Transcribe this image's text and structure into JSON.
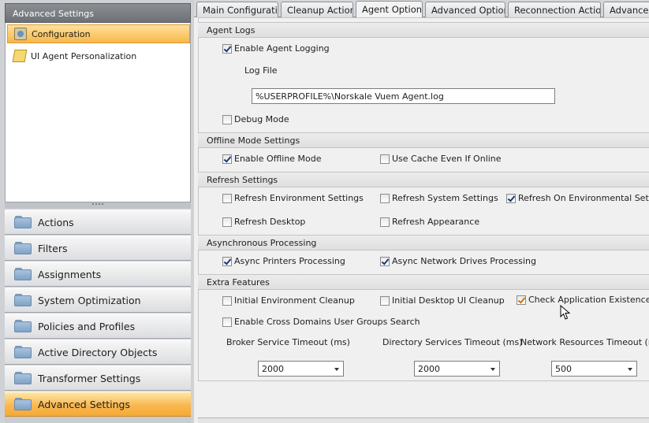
{
  "left_panel": {
    "header": "Advanced Settings",
    "tree": [
      {
        "label": "Configuration",
        "icon": "configuration-icon",
        "selected": true
      },
      {
        "label": "UI Agent Personalization",
        "icon": "ui-agent-icon",
        "selected": false
      }
    ],
    "nav": [
      {
        "label": "Actions",
        "active": false
      },
      {
        "label": "Filters",
        "active": false
      },
      {
        "label": "Assignments",
        "active": false
      },
      {
        "label": "System Optimization",
        "active": false
      },
      {
        "label": "Policies and Profiles",
        "active": false
      },
      {
        "label": "Active Directory Objects",
        "active": false
      },
      {
        "label": "Transformer Settings",
        "active": false
      },
      {
        "label": "Advanced Settings",
        "active": true
      }
    ]
  },
  "tabs": [
    {
      "label": "Main Configuration",
      "active": false
    },
    {
      "label": "Cleanup Actions",
      "active": false
    },
    {
      "label": "Agent Options",
      "active": true
    },
    {
      "label": "Advanced Options",
      "active": false
    },
    {
      "label": "Reconnection Actions",
      "active": false
    },
    {
      "label": "Advanced",
      "active": false
    }
  ],
  "agent_logs": {
    "title": "Agent Logs",
    "enable_logging": {
      "label": "Enable Agent Logging",
      "checked": true
    },
    "log_file_label": "Log File",
    "log_file_value": "%USERPROFILE%\\Norskale Vuem Agent.log",
    "debug_mode": {
      "label": "Debug Mode",
      "checked": false
    }
  },
  "offline_mode": {
    "title": "Offline Mode Settings",
    "enable_offline": {
      "label": "Enable Offline Mode",
      "checked": true
    },
    "use_cache": {
      "label": "Use Cache Even If Online",
      "checked": false
    }
  },
  "refresh": {
    "title": "Refresh Settings",
    "environment": {
      "label": "Refresh Environment Settings",
      "checked": false
    },
    "system": {
      "label": "Refresh System Settings",
      "checked": false
    },
    "on_environmental": {
      "label": "Refresh On Environmental Setting",
      "checked": true
    },
    "desktop": {
      "label": "Refresh Desktop",
      "checked": false
    },
    "appearance": {
      "label": "Refresh Appearance",
      "checked": false
    }
  },
  "async": {
    "title": "Asynchronous Processing",
    "printers": {
      "label": "Async Printers Processing",
      "checked": true
    },
    "network_drives": {
      "label": "Async Network Drives Processing",
      "checked": true
    }
  },
  "extra": {
    "title": "Extra Features",
    "initial_env_cleanup": {
      "label": "Initial Environment Cleanup",
      "checked": false
    },
    "initial_desktop_cleanup": {
      "label": "Initial Desktop UI Cleanup",
      "checked": false
    },
    "check_app_existence": {
      "label": "Check Application Existence",
      "checked": true
    },
    "cross_domains": {
      "label": "Enable Cross Domains User Groups Search",
      "checked": false
    },
    "broker_timeout": {
      "label": "Broker Service Timeout  (ms)",
      "value": "2000"
    },
    "directory_timeout": {
      "label": "Directory Services Timeout  (ms)",
      "value": "2000"
    },
    "network_timeout": {
      "label": "Network Resources Timeout  (ms)",
      "value": "500"
    }
  }
}
